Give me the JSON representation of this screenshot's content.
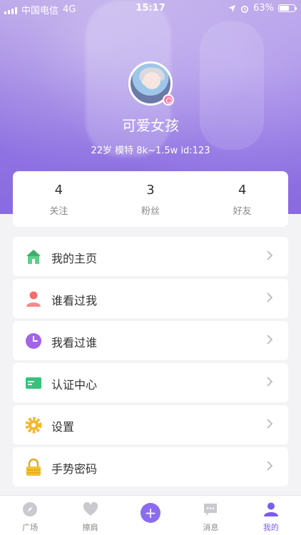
{
  "status_bar": {
    "carrier": "中国电信",
    "network": "4G",
    "time": "15:17",
    "battery": "63%",
    "battery_level": 63
  },
  "profile": {
    "nickname": "可爱女孩",
    "meta": "22岁  模特  8k~1.5w  id:123"
  },
  "stats": [
    {
      "value": "4",
      "label": "关注"
    },
    {
      "value": "3",
      "label": "粉丝"
    },
    {
      "value": "4",
      "label": "好友"
    }
  ],
  "menu": [
    {
      "label": "我的主页",
      "icon": "home-icon",
      "color": "#4cc07a"
    },
    {
      "label": "谁看过我",
      "icon": "user-icon",
      "color": "#f36f6f"
    },
    {
      "label": "我看过谁",
      "icon": "clock-icon",
      "color": "#a365e6"
    },
    {
      "label": "认证中心",
      "icon": "id-card-icon",
      "color": "#36c27b"
    },
    {
      "label": "设置",
      "icon": "gear-icon",
      "color": "#f4b82b"
    },
    {
      "label": "手势密码",
      "icon": "lock-icon",
      "color": "#f4c22b"
    }
  ],
  "tabs": [
    {
      "label": "广场",
      "icon": "compass-icon"
    },
    {
      "label": "擦肩",
      "icon": "heart-icon"
    },
    {
      "label": "",
      "icon": "plus-icon"
    },
    {
      "label": "消息",
      "icon": "chat-icon"
    },
    {
      "label": "我的",
      "icon": "person-icon"
    }
  ],
  "colors": {
    "accent": "#7b5cf0",
    "hero_start": "#b7a2e8",
    "hero_end": "#8a6be0"
  }
}
